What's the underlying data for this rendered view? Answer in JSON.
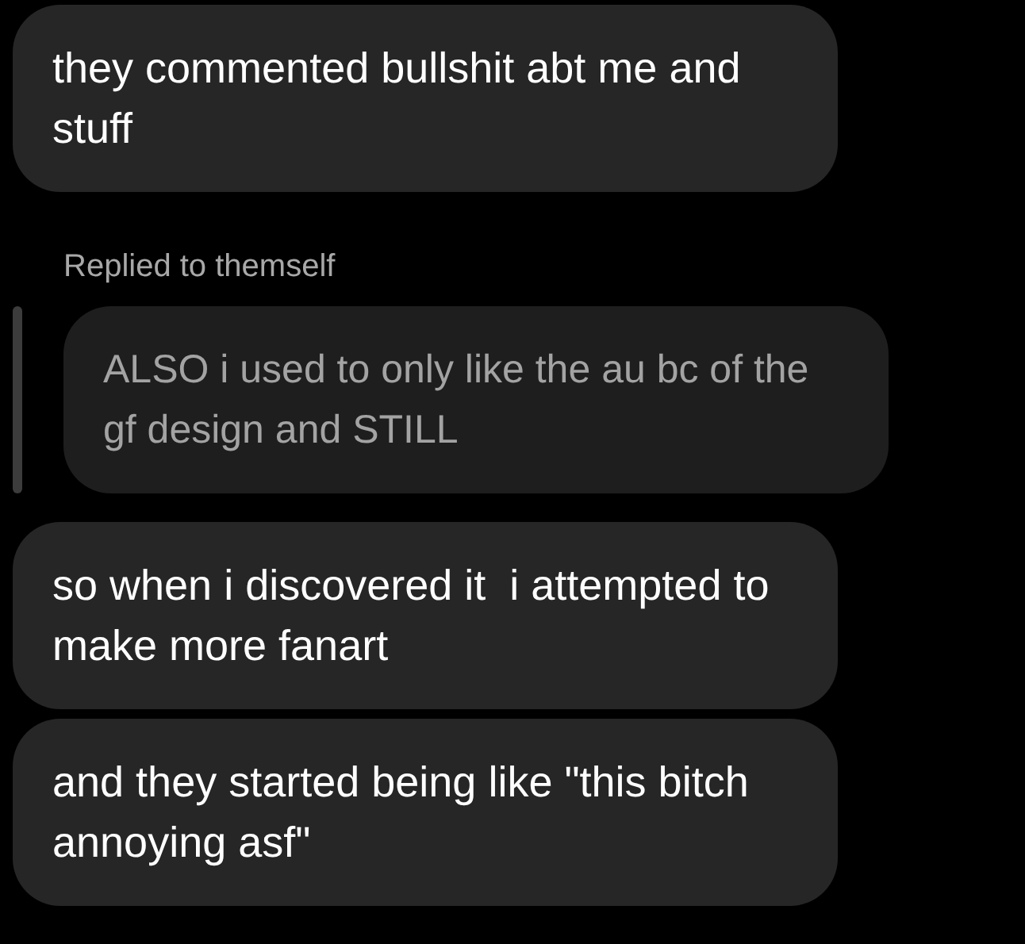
{
  "messages": [
    {
      "kind": "message",
      "text": "they commented bullshit abt me and stuff"
    },
    {
      "kind": "reply",
      "label": "Replied to themself",
      "quote": "ALSO i used to only like the au bc of the gf design and STILL"
    },
    {
      "kind": "message",
      "text": "so when i discovered it  i attempted to make more fanart"
    },
    {
      "kind": "message",
      "text": "and they started being like \"this bitch annoying asf\""
    }
  ]
}
